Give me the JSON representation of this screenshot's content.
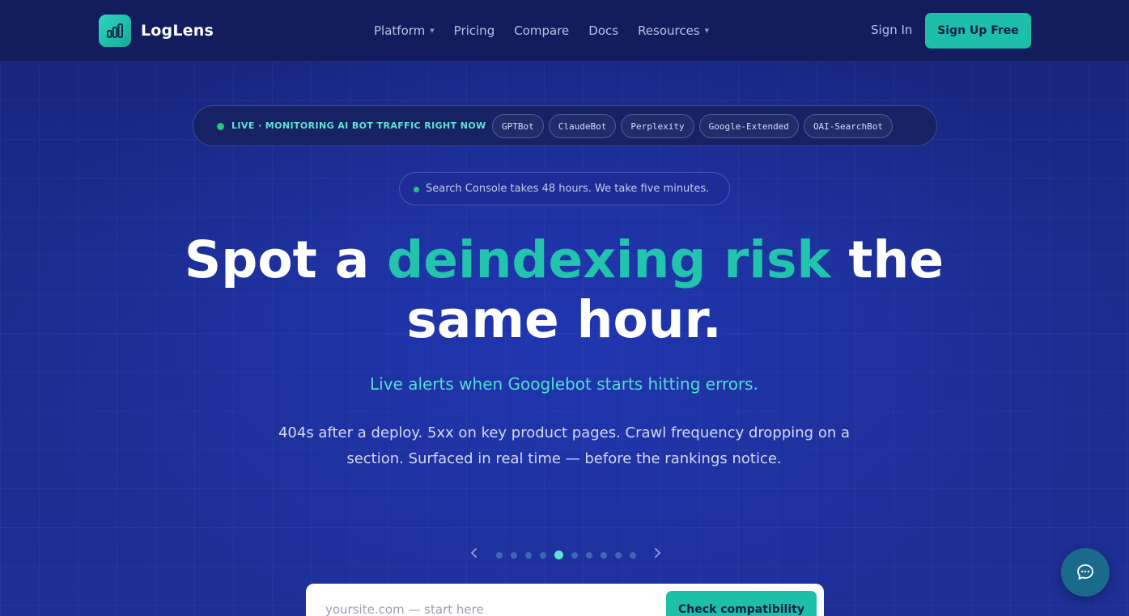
{
  "brand": {
    "name": "LogLens",
    "logo_icon": "bar-chart-icon",
    "accent": "#1dbfa8"
  },
  "nav": {
    "items": [
      {
        "label": "Platform",
        "has_dropdown": true
      },
      {
        "label": "Pricing",
        "has_dropdown": false
      },
      {
        "label": "Compare",
        "has_dropdown": false
      },
      {
        "label": "Docs",
        "has_dropdown": false
      },
      {
        "label": "Resources",
        "has_dropdown": true
      }
    ],
    "signin_label": "Sign In",
    "signup_label": "Sign Up Free"
  },
  "live_bar": {
    "status_text": "LIVE · MONITORING AI BOT TRAFFIC RIGHT NOW",
    "bots": [
      "GPTBot",
      "ClaudeBot",
      "Perplexity",
      "Google-Extended",
      "OAI-SearchBot"
    ]
  },
  "pill": {
    "text": "Search Console takes 48 hours. We take five minutes."
  },
  "hero": {
    "headline_pre": "Spot a ",
    "headline_accent": "deindexing risk",
    "headline_post": " the same hour.",
    "subhead": "Live alerts when Googlebot starts hitting errors.",
    "body": "404s after a deploy. 5xx on key product pages. Crawl frequency dropping on a section. Surfaced in real time — before the rankings notice."
  },
  "carousel": {
    "total": 10,
    "active": 5,
    "prev_icon": "chevron-left-icon",
    "next_icon": "chevron-right-icon"
  },
  "form": {
    "placeholder": "yoursite.com — start here",
    "button_label": "Check compatibility"
  },
  "chat": {
    "icon": "chat-bubble-icon"
  }
}
